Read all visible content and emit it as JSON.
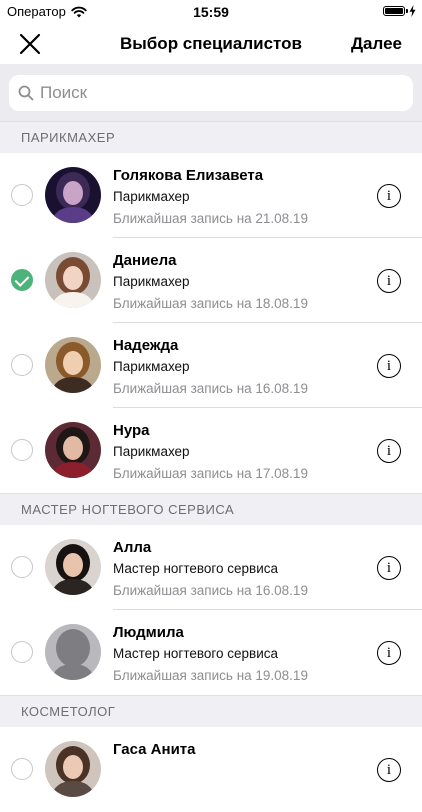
{
  "status_bar": {
    "carrier": "Оператор",
    "time": "15:59",
    "battery_level": 1.0,
    "icons": [
      "wifi-icon",
      "battery-icon",
      "charging-bolt-icon"
    ]
  },
  "nav": {
    "close_icon": "close-icon",
    "title": "Выбор специалистов",
    "next_label": "Далее"
  },
  "search": {
    "placeholder": "Поиск",
    "value": "",
    "icon": "search-icon"
  },
  "colors": {
    "accent_check": "#4cb37a",
    "section_bg": "#efeff4",
    "secondary_text": "#8e8e93"
  },
  "sections": [
    {
      "title": "ПАРИКМАХЕР",
      "specialists": [
        {
          "name": "Голякова Елизавета",
          "role": "Парикмахер",
          "next": "Ближайшая запись на 21.08.19",
          "selected": false
        },
        {
          "name": "Даниела",
          "role": "Парикмахер",
          "next": "Ближайшая запись на 18.08.19",
          "selected": true
        },
        {
          "name": "Надежда",
          "role": "Парикмахер",
          "next": "Ближайшая запись на 16.08.19",
          "selected": false
        },
        {
          "name": "Нура",
          "role": "Парикмахер",
          "next": "Ближайшая запись на 17.08.19",
          "selected": false
        }
      ]
    },
    {
      "title": "МАСТЕР НОГТЕВОГО СЕРВИСА",
      "specialists": [
        {
          "name": "Алла",
          "role": "Мастер ногтевого сервиса",
          "next": "Ближайшая запись на 16.08.19",
          "selected": false
        },
        {
          "name": "Людмила",
          "role": "Мастер ногтевого сервиса",
          "next": "Ближайшая запись на 19.08.19",
          "selected": false
        }
      ]
    },
    {
      "title": "КОСМЕТОЛОГ",
      "specialists": [
        {
          "name": "Гаса Анита",
          "role": "",
          "next": "",
          "selected": false
        }
      ]
    }
  ]
}
